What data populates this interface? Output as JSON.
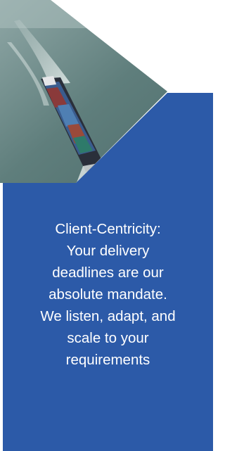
{
  "colors": {
    "panel_blue": "#2C5AA8",
    "sea": "#4A6A6A",
    "background": "#FFFFFF"
  },
  "image": {
    "subject": "container-ship-photo"
  },
  "caption": {
    "lines": [
      "Client-Centricity:",
      "Your delivery",
      "deadlines are our",
      "absolute mandate.",
      "We listen, adapt, and",
      "scale to your",
      "requirements"
    ]
  }
}
